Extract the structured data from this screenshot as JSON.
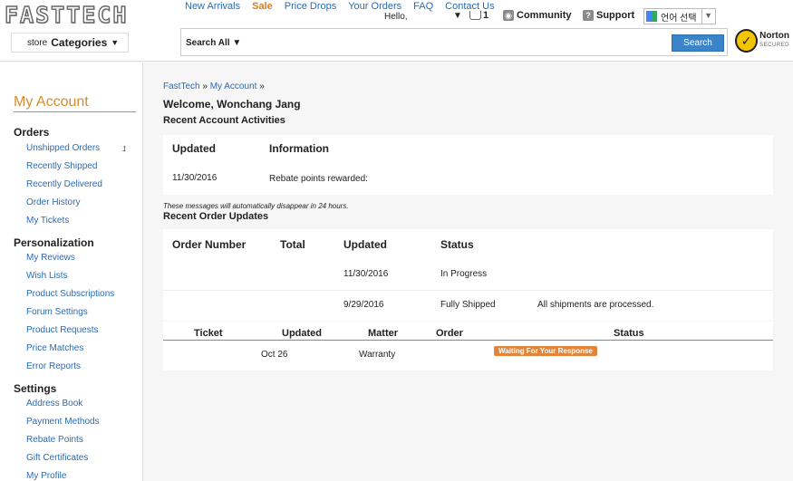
{
  "header": {
    "logo": "FASTTECH",
    "nav": [
      "New Arrivals",
      "Sale",
      "Price Drops",
      "Your Orders",
      "FAQ",
      "Contact Us"
    ],
    "hello": "Hello,",
    "cart_count": "1",
    "community": "Community",
    "support": "Support",
    "language": "언어 선택",
    "categories_prefix": "store",
    "categories_label": "Categories",
    "search_scope": "Search All",
    "search_value": "",
    "search_button": "Search",
    "norton_line1": "Norton",
    "norton_line2": "SECURED"
  },
  "sidebar": {
    "title": "My Account",
    "sections": [
      {
        "heading": "Orders",
        "items": [
          "Unshipped Orders",
          "Recently Shipped",
          "Recently Delivered",
          "Order History",
          "My Tickets"
        ],
        "unshipped_count": "1"
      },
      {
        "heading": "Personalization",
        "items": [
          "My Reviews",
          "Wish Lists",
          "Product Subscriptions",
          "Forum Settings",
          "Product Requests",
          "Price Matches",
          "Error Reports"
        ]
      },
      {
        "heading": "Settings",
        "items": [
          "Address Book",
          "Payment Methods",
          "Rebate Points",
          "Gift Certificates",
          "My Profile"
        ]
      }
    ]
  },
  "main": {
    "breadcrumb": [
      "FastTech",
      "My Account"
    ],
    "breadcrumb_sep": "»",
    "welcome": "Welcome, Wonchang Jang",
    "activities": {
      "title": "Recent Account Activities",
      "headers": [
        "Updated",
        "Information"
      ],
      "rows": [
        {
          "updated": "11/30/2016",
          "information": "Rebate points rewarded:"
        }
      ],
      "note": "These messages will automatically disappear in 24 hours."
    },
    "orders": {
      "title": "Recent Order Updates",
      "headers": [
        "Order Number",
        "Total",
        "Updated",
        "Status"
      ],
      "rows": [
        {
          "order": "",
          "total": "",
          "updated": "11/30/2016",
          "status": "In Progress",
          "note": ""
        },
        {
          "order": "",
          "total": "",
          "updated": "9/29/2016",
          "status": "Fully Shipped",
          "note": "All shipments are processed."
        }
      ]
    },
    "tickets": {
      "headers": [
        "Ticket",
        "Updated",
        "Matter",
        "Order",
        "Status"
      ],
      "rows": [
        {
          "ticket": "",
          "updated": "Oct 26",
          "matter": "Warranty",
          "order": "",
          "status": "Waiting For Your Response"
        }
      ]
    }
  },
  "colors": {
    "link": "#2a6bb5",
    "accent": "#d68b2e",
    "sale": "#e07b1f",
    "search_button": "#3c84c9",
    "status_badge": "#e2853a"
  }
}
